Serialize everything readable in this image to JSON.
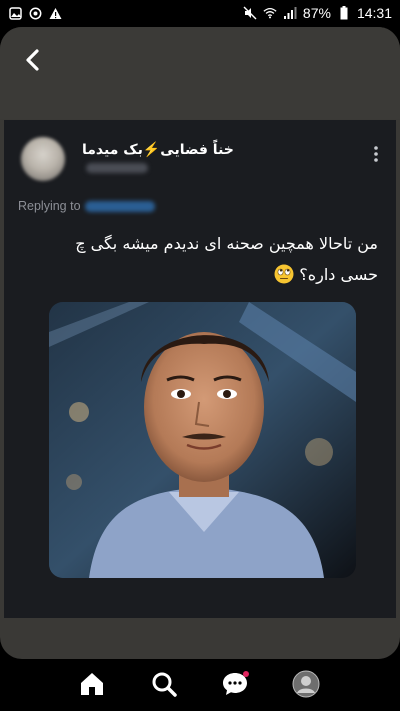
{
  "status_bar": {
    "battery": "87%",
    "time": "14:31",
    "left_icons": [
      "gallery-icon",
      "whatsapp-icon",
      "warning-icon"
    ],
    "right_icons": [
      "mute-icon",
      "wifi-icon",
      "signal-icon",
      "battery-icon"
    ]
  },
  "header": {
    "back_icon": "chevron-left-icon"
  },
  "tweet": {
    "username": "خناً فضایی⚡️بک میدما",
    "replying_label": "Replying to",
    "text_line1": "من تاحالا همچین صحنه ای ندیدم میشه بگی چ",
    "text_line2": "حسی داره؟",
    "emoji": "face-with-rolling-eyes"
  },
  "nav": {
    "items": [
      "home-icon",
      "search-icon",
      "messages-icon",
      "profile-avatar"
    ],
    "active": "home-icon",
    "notification_color": "#e0245e"
  },
  "colors": {
    "tweet_bg": "#1a1c20",
    "frame_bg": "#3a3936",
    "muted_text": "#8c8f96"
  }
}
